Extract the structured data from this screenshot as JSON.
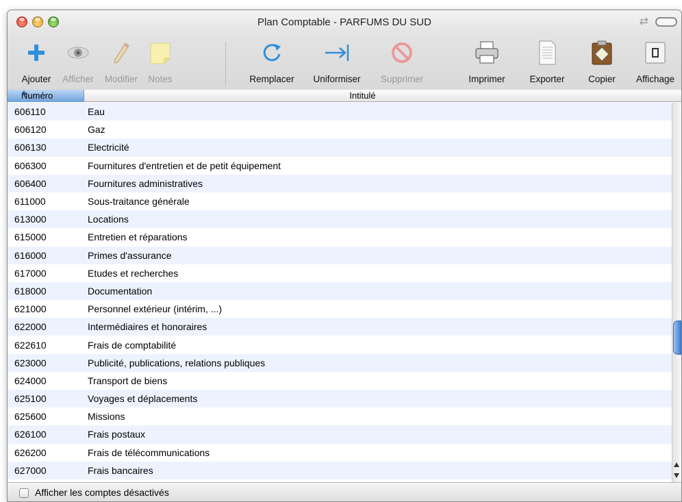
{
  "window": {
    "title": "Plan Comptable - PARFUMS DU SUD"
  },
  "toolbar": {
    "ajouter": "Ajouter",
    "afficher": "Afficher",
    "modifier": "Modifier",
    "notes": "Notes",
    "remplacer": "Remplacer",
    "uniformiser": "Uniformiser",
    "supprimer": "Supprimer",
    "imprimer": "Imprimer",
    "exporter": "Exporter",
    "copier": "Copier",
    "affichage": "Affichage"
  },
  "table": {
    "headers": {
      "numero": "Numéro",
      "intitule": "Intitulé"
    },
    "rows": [
      {
        "numero": "606110",
        "intitule": "Eau"
      },
      {
        "numero": "606120",
        "intitule": "Gaz"
      },
      {
        "numero": "606130",
        "intitule": "Electricité"
      },
      {
        "numero": "606300",
        "intitule": "Fournitures d'entretien et de petit équipement"
      },
      {
        "numero": "606400",
        "intitule": "Fournitures administratives"
      },
      {
        "numero": "611000",
        "intitule": "Sous-traitance générale"
      },
      {
        "numero": "613000",
        "intitule": "Locations"
      },
      {
        "numero": "615000",
        "intitule": "Entretien et réparations"
      },
      {
        "numero": "616000",
        "intitule": "Primes d'assurance"
      },
      {
        "numero": "617000",
        "intitule": "Etudes et recherches"
      },
      {
        "numero": "618000",
        "intitule": "Documentation"
      },
      {
        "numero": "621000",
        "intitule": "Personnel extérieur (intérim, ...)"
      },
      {
        "numero": "622000",
        "intitule": "Intermédiaires et honoraires"
      },
      {
        "numero": "622610",
        "intitule": "Frais de comptabilité"
      },
      {
        "numero": "623000",
        "intitule": "Publicité, publications, relations publiques"
      },
      {
        "numero": "624000",
        "intitule": "Transport de biens"
      },
      {
        "numero": "625100",
        "intitule": "Voyages et déplacements"
      },
      {
        "numero": "625600",
        "intitule": "Missions"
      },
      {
        "numero": "626100",
        "intitule": "Frais postaux"
      },
      {
        "numero": "626200",
        "intitule": "Frais de télécommunications"
      },
      {
        "numero": "627000",
        "intitule": "Frais bancaires"
      },
      {
        "numero": "",
        "intitule": ""
      }
    ]
  },
  "footer": {
    "checkbox_label": "Afficher les comptes désactivés",
    "checked": false
  },
  "colors": {
    "selected_header": "#6ea1dc",
    "row_alt": "#edf3fe",
    "disabled_text": "#9a9a9a"
  }
}
